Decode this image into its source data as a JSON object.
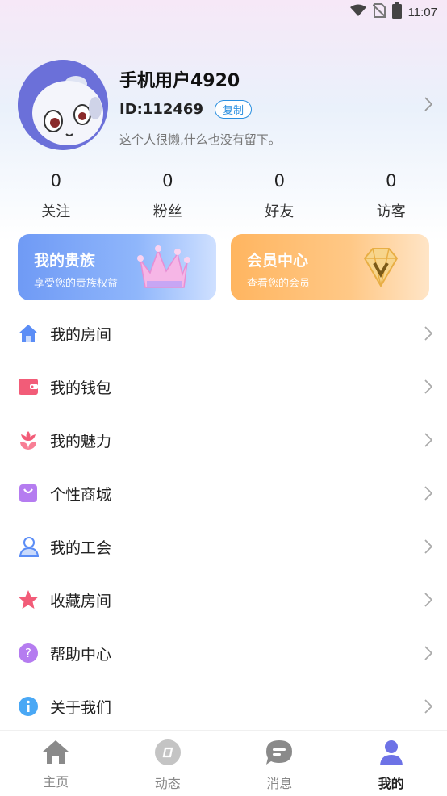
{
  "status_bar": {
    "time": "11:07"
  },
  "profile": {
    "name": "手机用户4920",
    "id_text": "ID:112469",
    "copy_label": "复制",
    "signature": "这个人很懒,什么也没有留下。"
  },
  "stats": [
    {
      "value": "0",
      "label": "关注"
    },
    {
      "value": "0",
      "label": "粉丝"
    },
    {
      "value": "0",
      "label": "好友"
    },
    {
      "value": "0",
      "label": "访客"
    }
  ],
  "cards": {
    "noble": {
      "title": "我的贵族",
      "subtitle": "享受您的贵族权益"
    },
    "vip": {
      "title": "会员中心",
      "subtitle": "查看您的会员"
    }
  },
  "menu": [
    {
      "label": "我的房间",
      "icon": "home-icon",
      "color": "#5b8df6"
    },
    {
      "label": "我的钱包",
      "icon": "wallet-icon",
      "color": "#f25c78"
    },
    {
      "label": "我的魅力",
      "icon": "flower-icon",
      "color": "#f25c78"
    },
    {
      "label": "个性商城",
      "icon": "shopping-bag-icon",
      "color": "#b57cf0"
    },
    {
      "label": "我的工会",
      "icon": "guild-icon",
      "color": "#5b8df6"
    },
    {
      "label": "收藏房间",
      "icon": "star-icon",
      "color": "#f25c78"
    },
    {
      "label": "帮助中心",
      "icon": "help-icon",
      "color": "#b57cf0"
    },
    {
      "label": "关于我们",
      "icon": "info-icon",
      "color": "#4aa8f5"
    }
  ],
  "tabs": [
    {
      "label": "主页",
      "icon": "home-tab-icon"
    },
    {
      "label": "动态",
      "icon": "compass-icon"
    },
    {
      "label": "消息",
      "icon": "message-icon"
    },
    {
      "label": "我的",
      "icon": "profile-tab-icon",
      "active": true
    }
  ]
}
